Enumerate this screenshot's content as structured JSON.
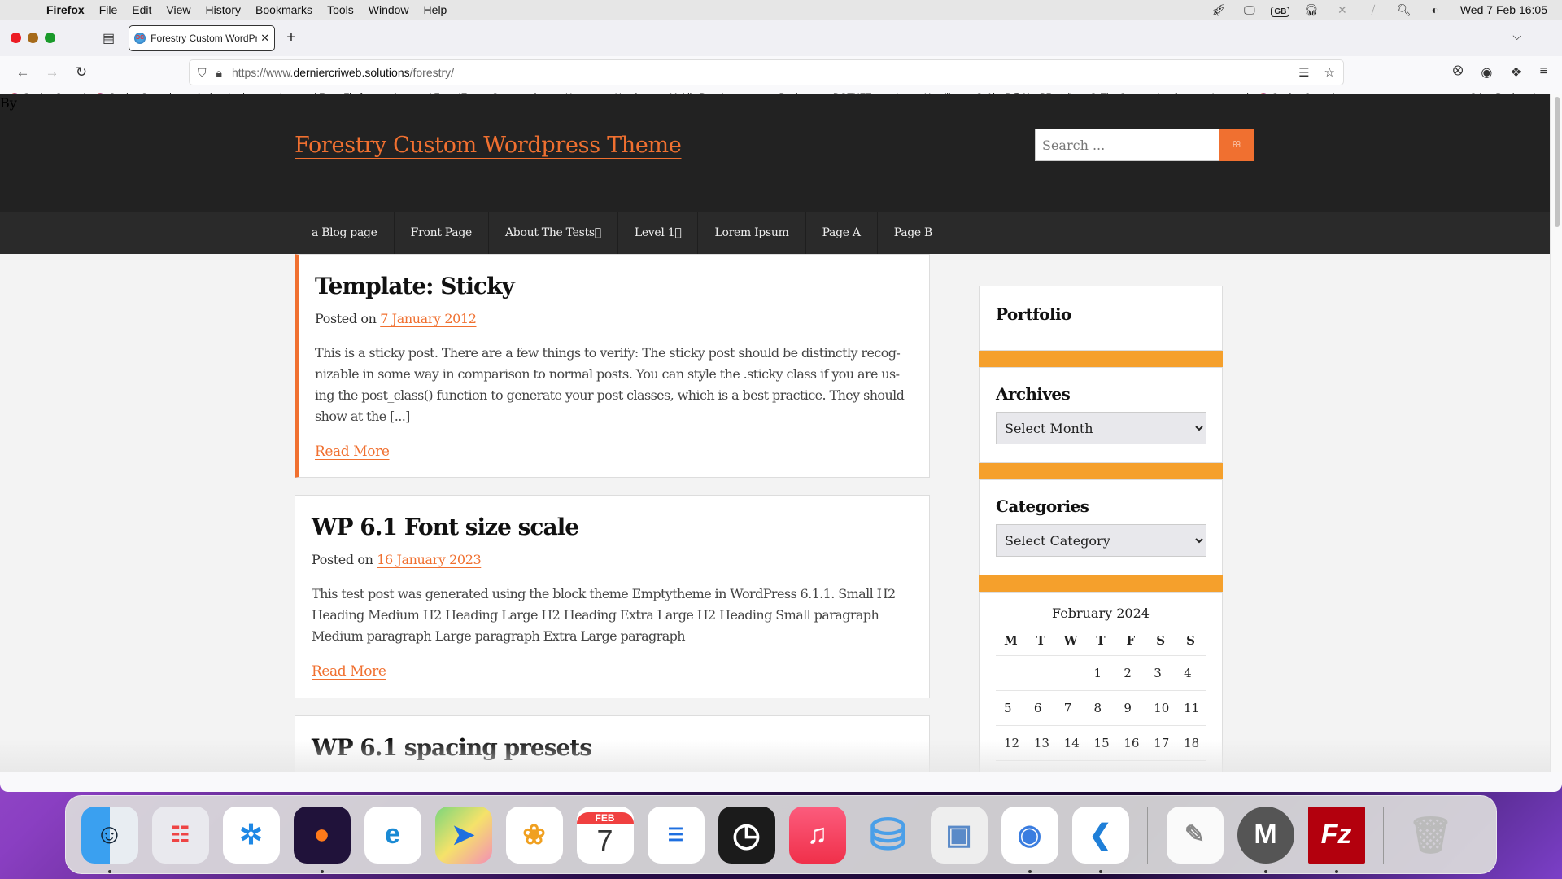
{
  "menubar": {
    "app_name": "Firefox",
    "items": [
      "File",
      "Edit",
      "View",
      "History",
      "Bookmarks",
      "Tools",
      "Window",
      "Help"
    ],
    "status_icons": [
      "rocket-icon",
      "display-icon",
      "keyboard-layout-icon",
      "headphones-icon",
      "bluetooth-off-icon",
      "wifi-off-icon",
      "search-icon",
      "control-center-icon"
    ],
    "keyboard_layout": "GB",
    "clock": "Wed 7 Feb  16:05"
  },
  "browser": {
    "tab": {
      "title": "Forestry Custom WordPress Theme",
      "favicon": "DC"
    },
    "new_tab_label": "+",
    "url": {
      "prefix": "https://www.",
      "domain": "derniercriweb.solutions",
      "path": "/forestry/"
    },
    "bookmarks": [
      {
        "label": "Getting Started",
        "icon": "firefox-icon"
      },
      {
        "label": "Getting Started",
        "icon": "firefox-icon"
      },
      {
        "label": "Authentication",
        "icon": "folder-icon"
      },
      {
        "label": "Imported From Firef...",
        "icon": "folder-icon"
      },
      {
        "label": "Imported From IE",
        "icon": "folder-icon"
      },
      {
        "label": "Crosswords",
        "icon": "folder-icon"
      },
      {
        "label": "Home",
        "icon": "folder-icon"
      },
      {
        "label": "Heroku",
        "icon": "folder-icon"
      },
      {
        "label": "Mobile Development",
        "icon": "folder-icon"
      },
      {
        "label": "Docker",
        "icon": "folder-icon"
      },
      {
        "label": "DOTNET",
        "icon": "folder-icon"
      },
      {
        "label": "Latest Headlines",
        "icon": "folder-icon"
      },
      {
        "label": "AlanB@AlanBRadcli...",
        "icon": "globe-icon"
      },
      {
        "label": "The Community of ...",
        "icon": "globe-icon"
      },
      {
        "label": "Imported",
        "icon": "folder-icon"
      },
      {
        "label": "Getting Started",
        "icon": "firefox-icon"
      }
    ],
    "other_bookmarks": "Other Bookmarks"
  },
  "site": {
    "by_text": "By",
    "title": "Forestry Custom Wordpress Theme",
    "search_placeholder": "Search ...",
    "search_button_glyph": "",
    "nav": [
      "a Blog page",
      "Front Page",
      "About The Tests",
      "Level 1",
      "Lorem Ipsum",
      "Page A",
      "Page B"
    ],
    "posts": [
      {
        "title": "Template: Sticky",
        "posted_on": "Posted on",
        "date": "7 January 2012",
        "excerpt": "This is a sticky post. There are a few things to verify: The sticky post should be distinctly recog-nizable in some way in comparison to normal posts. You can style the .sticky class if you are us-ing the post_class() function to generate your post classes, which is a best practice. They should show at the [...]",
        "read_more": "Read More"
      },
      {
        "title": "WP 6.1 Font size scale",
        "posted_on": "Posted on",
        "date": "16 January 2023",
        "excerpt": "This test post was generated using the block theme Emptytheme in WordPress 6.1.1. Small H2 Heading Medium H2 Heading Large H2 Heading Extra Large H2 Heading Small paragraph Medium paragraph Large paragraph Extra Large paragraph",
        "read_more": "Read More"
      },
      {
        "title": "WP 6.1 spacing presets"
      }
    ],
    "sidebar": {
      "portfolio_title": "Portfolio",
      "archives_title": "Archives",
      "archives_select": "Select Month",
      "categories_title": "Categories",
      "categories_select": "Select Category",
      "calendar": {
        "caption": "February 2024",
        "weekdays": [
          "M",
          "T",
          "W",
          "T",
          "F",
          "S",
          "S"
        ],
        "weeks": [
          [
            "",
            "",
            "",
            "1",
            "2",
            "3",
            "4"
          ],
          [
            "5",
            "6",
            "7",
            "8",
            "9",
            "10",
            "11"
          ],
          [
            "12",
            "13",
            "14",
            "15",
            "16",
            "17",
            "18"
          ]
        ]
      }
    },
    "colors": {
      "accent": "#f07030",
      "widget_separator": "#f5a02c",
      "header_bg": "#222222",
      "nav_bg": "#2a2a2a"
    }
  },
  "dock": {
    "apps": [
      {
        "name": "Finder",
        "running": true
      },
      {
        "name": "Launchpad",
        "running": false
      },
      {
        "name": "Safari",
        "running": false
      },
      {
        "name": "Firefox",
        "running": true
      },
      {
        "name": "Microsoft Edge",
        "running": false
      },
      {
        "name": "Maps",
        "running": false
      },
      {
        "name": "Photos",
        "running": false
      },
      {
        "name": "Calendar",
        "running": false,
        "month": "FEB",
        "day": "7"
      },
      {
        "name": "Reminders",
        "running": false
      },
      {
        "name": "Clock",
        "running": false
      },
      {
        "name": "Music",
        "running": false
      },
      {
        "name": "Database",
        "running": false
      },
      {
        "name": "Preview",
        "running": false
      },
      {
        "name": "Google Chrome",
        "running": true
      },
      {
        "name": "Visual Studio Code",
        "running": true
      }
    ],
    "recent": [
      {
        "name": "TextEdit",
        "running": false
      },
      {
        "name": "MAMP",
        "running": true
      },
      {
        "name": "FileZilla",
        "running": true
      }
    ],
    "trash": "Trash"
  }
}
